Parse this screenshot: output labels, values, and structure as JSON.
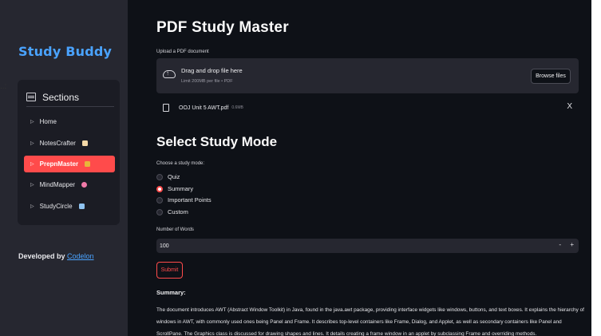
{
  "sidebar": {
    "brand": "Study Buddy",
    "sections_label": "Sections",
    "items": [
      {
        "label": "Home",
        "emoji": ""
      },
      {
        "label": "NotesCrafter",
        "emoji": "memo"
      },
      {
        "label": "PrepnMaster",
        "emoji": "trophy"
      },
      {
        "label": "MindMapper",
        "emoji": "brain"
      },
      {
        "label": "StudyCircle",
        "emoji": "book"
      }
    ],
    "active_index": 2,
    "developer_prefix": "Developed by ",
    "developer_link": "Codelon"
  },
  "edge_dots": "..:",
  "main": {
    "title": "PDF Study Master",
    "upload": {
      "label": "Upload a PDF document",
      "drop_title": "Drag and drop file here",
      "drop_sub": "Limit 200MB per file • PDF",
      "browse_label": "Browse files",
      "file_name": "OOJ Unit 5 AWT.pdf",
      "file_size": "0.6MB",
      "close_glyph": "X"
    },
    "mode": {
      "heading": "Select Study Mode",
      "label": "Choose a study mode:",
      "options": [
        "Quiz",
        "Summary",
        "Important Points",
        "Custom"
      ],
      "selected_index": 1
    },
    "words": {
      "label": "Number of Words",
      "value": "100",
      "minus": "-",
      "plus": "+"
    },
    "submit_label": "Submit",
    "summary_label": "Summary:",
    "summary_text": "The document introduces AWT (Abstract Window Toolkit) in Java, found in the java.awt package, providing interface widgets like windows, buttons, and text boxes. It explains the hierarchy of windows in AWT, with commonly used ones being Panel and Frame. It describes top-level containers like Frame, Dialog, and Applet, as well as secondary containers like Panel and ScrollPane. The Graphics class is discussed for drawing shapes and lines. It details creating a frame window in an applet by subclassing Frame and overriding methods."
  },
  "colors": {
    "sidebar_bg": "#262730",
    "main_bg": "#0e1117",
    "accent": "#ff4b4b",
    "brand": "#4aa3ff"
  }
}
